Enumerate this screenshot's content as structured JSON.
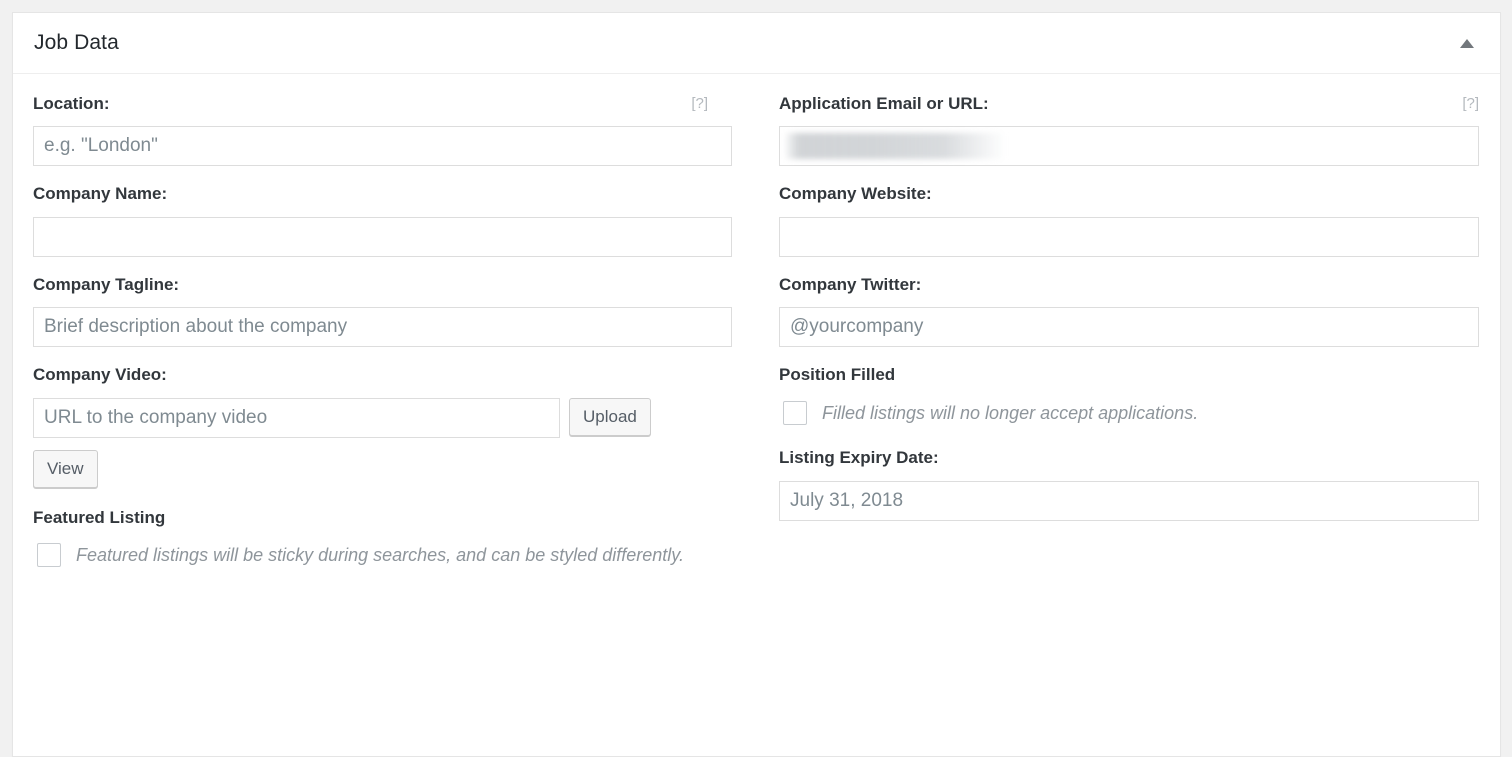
{
  "panel": {
    "title": "Job Data",
    "toggle_icon": "caret-up-icon"
  },
  "fields": {
    "location": {
      "label": "Location:",
      "placeholder": "e.g. \"London\"",
      "value": "",
      "help": "[?]"
    },
    "application": {
      "label": "Application Email or URL:",
      "placeholder": "",
      "value": "",
      "help": "[?]",
      "redacted": true
    },
    "company_name": {
      "label": "Company Name:",
      "placeholder": "",
      "value": ""
    },
    "company_website": {
      "label": "Company Website:",
      "placeholder": "",
      "value": ""
    },
    "company_tagline": {
      "label": "Company Tagline:",
      "placeholder": "Brief description about the company",
      "value": ""
    },
    "company_twitter": {
      "label": "Company Twitter:",
      "placeholder": "@yourcompany",
      "value": ""
    },
    "company_video": {
      "label": "Company Video:",
      "placeholder": "URL to the company video",
      "value": "",
      "upload_label": "Upload",
      "view_label": "View"
    },
    "position_filled": {
      "label": "Position Filled",
      "description": "Filled listings will no longer accept applications.",
      "checked": false
    },
    "featured_listing": {
      "label": "Featured Listing",
      "description": "Featured listings will be sticky during searches, and can be styled differently.",
      "checked": false
    },
    "listing_expiry": {
      "label": "Listing Expiry Date:",
      "placeholder": "July 31, 2018",
      "value": ""
    }
  },
  "colors": {
    "page_background": "#f1f1f1",
    "panel_background": "#ffffff",
    "panel_border": "#e5e5e5",
    "label_text": "#32373c",
    "placeholder_text": "#7f8a91",
    "help_tip": "#b4b9be",
    "muted_italic": "#8e959b",
    "input_border": "#dddddd",
    "button_background": "#f7f7f7",
    "button_border": "#cccccc"
  }
}
